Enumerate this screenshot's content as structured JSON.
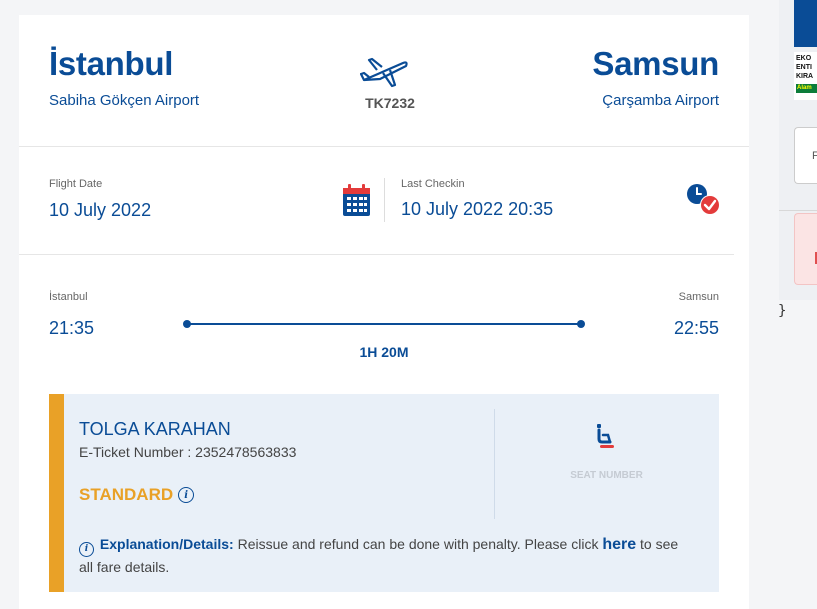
{
  "flight": {
    "origin_city": "İstanbul",
    "origin_airport": "Sabiha Gökçen Airport",
    "destination_city": "Samsun",
    "destination_airport": "Çarşamba Airport",
    "flight_number": "TK7232"
  },
  "dates": {
    "flight_date_label": "Flight Date",
    "flight_date": "10 July 2022",
    "last_checkin_label": "Last Checkin",
    "last_checkin": "10 July 2022 20:35"
  },
  "route": {
    "origin_city_small": "İstanbul",
    "destination_city_small": "Samsun",
    "departure_time": "21:35",
    "arrival_time": "22:55",
    "duration": "1H 20M"
  },
  "passenger": {
    "name": "TOLGA KARAHAN",
    "ticket_label": "E-Ticket Number : ",
    "ticket_number": "2352478563833",
    "fare_class": "STANDARD",
    "seat_label": "SEAT NUMBER",
    "explanation_title": "Explanation/Details:",
    "explanation_text_1": " Reissue and refund can be done with penalty. Please click ",
    "explanation_link": "here",
    "explanation_text_2": " to see all fare details."
  },
  "side_panel": {
    "logo_line1": "EKO",
    "logo_line2": "ENTI",
    "logo_line3": "KIRA",
    "logo_badge": "Alam",
    "box_text": "F",
    "brace": "}"
  },
  "colors": {
    "brand_blue": "#0a4c96",
    "accent_orange": "#e9a127",
    "panel_bg": "#e9f0f8",
    "alert_red": "#e33b3b"
  },
  "icons": {
    "plane": "airplane-departure-icon",
    "calendar": "calendar-icon",
    "clock": "clock-check-icon",
    "seat": "seat-icon",
    "info": "info-icon"
  }
}
